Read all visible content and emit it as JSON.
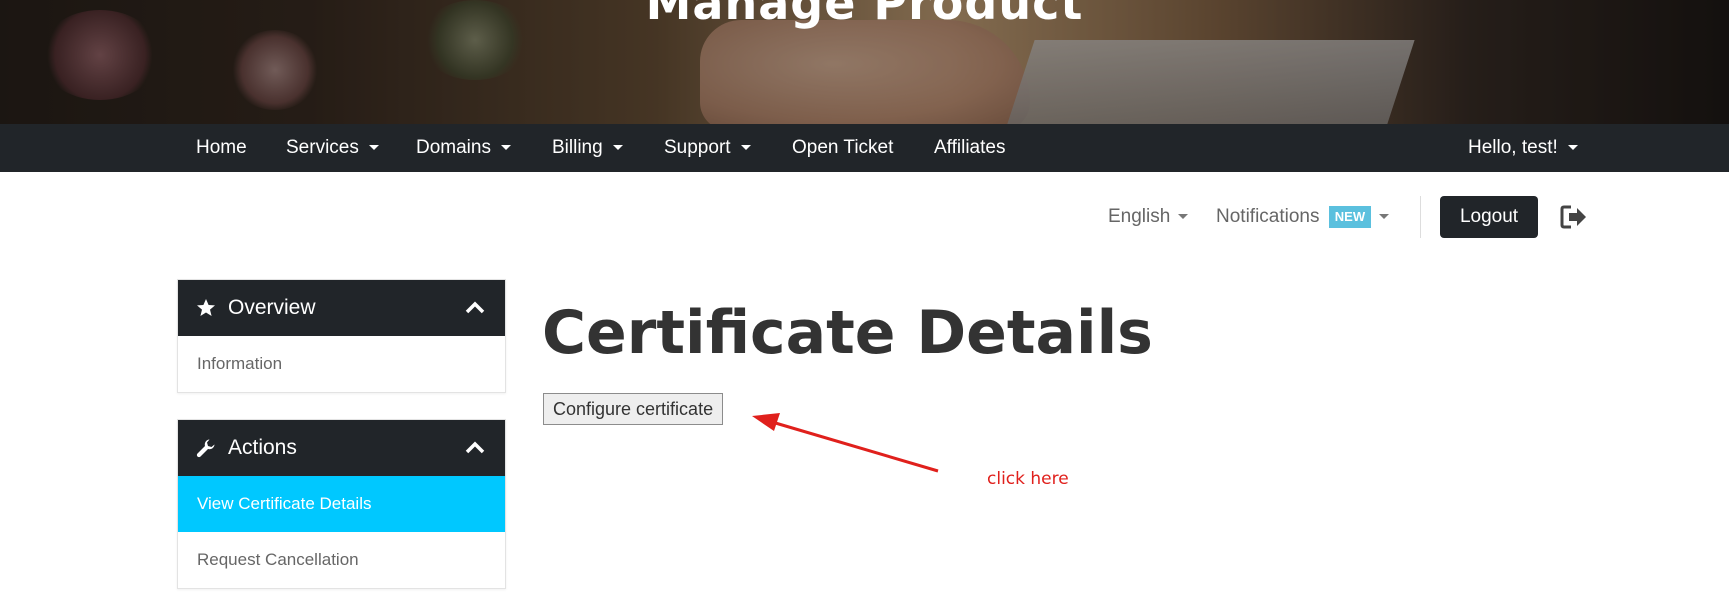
{
  "hero": {
    "title": "Manage Product"
  },
  "navbar": {
    "items": [
      {
        "label": "Home",
        "dropdown": false
      },
      {
        "label": "Services",
        "dropdown": true
      },
      {
        "label": "Domains",
        "dropdown": true
      },
      {
        "label": "Billing",
        "dropdown": true
      },
      {
        "label": "Support",
        "dropdown": true
      },
      {
        "label": "Open Ticket",
        "dropdown": false
      },
      {
        "label": "Affiliates",
        "dropdown": false
      }
    ],
    "user_menu": "Hello, test!"
  },
  "topbar": {
    "language": "English",
    "notifications": "Notifications",
    "notifications_badge": "NEW",
    "logout_label": "Logout",
    "logout_icon": "sign-out-icon"
  },
  "sidebar": {
    "overview": {
      "title": "Overview",
      "icon": "star-icon",
      "items": [
        {
          "label": "Information",
          "active": false
        }
      ]
    },
    "actions": {
      "title": "Actions",
      "icon": "wrench-icon",
      "items": [
        {
          "label": "View Certificate Details",
          "active": true
        },
        {
          "label": "Request Cancellation",
          "active": false
        }
      ]
    }
  },
  "main": {
    "title": "Certificate Details",
    "configure_button": "Configure certificate"
  },
  "annotation": {
    "text": "click here",
    "color": "#e0201c"
  },
  "colors": {
    "navbar": "#212529",
    "accent": "#00c8ff",
    "badge": "#5bc0de"
  }
}
